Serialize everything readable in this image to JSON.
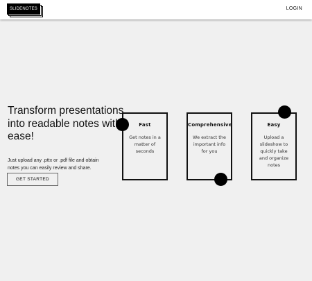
{
  "navbar": {
    "logo_text": "SLIDENOTES",
    "login_label": "LOGIN"
  },
  "hero": {
    "title": "Transform presentations into readable notes with ease!",
    "subtitle": "Just upload any .pttx or .pdf file and obtain notes you can easily review and share.",
    "cta_label": "GET STARTED"
  },
  "features": [
    {
      "title": "Fast",
      "description": "Get notes in a matter of seconds"
    },
    {
      "title": "Comprehensive",
      "description": "We extract the important info for you"
    },
    {
      "title": "Easy",
      "description": "Upload a slideshow to quickly take and organize notes"
    }
  ],
  "colors": {
    "background": "#f0f0f0",
    "navbar": "#ffffff",
    "accent": "#000000"
  }
}
